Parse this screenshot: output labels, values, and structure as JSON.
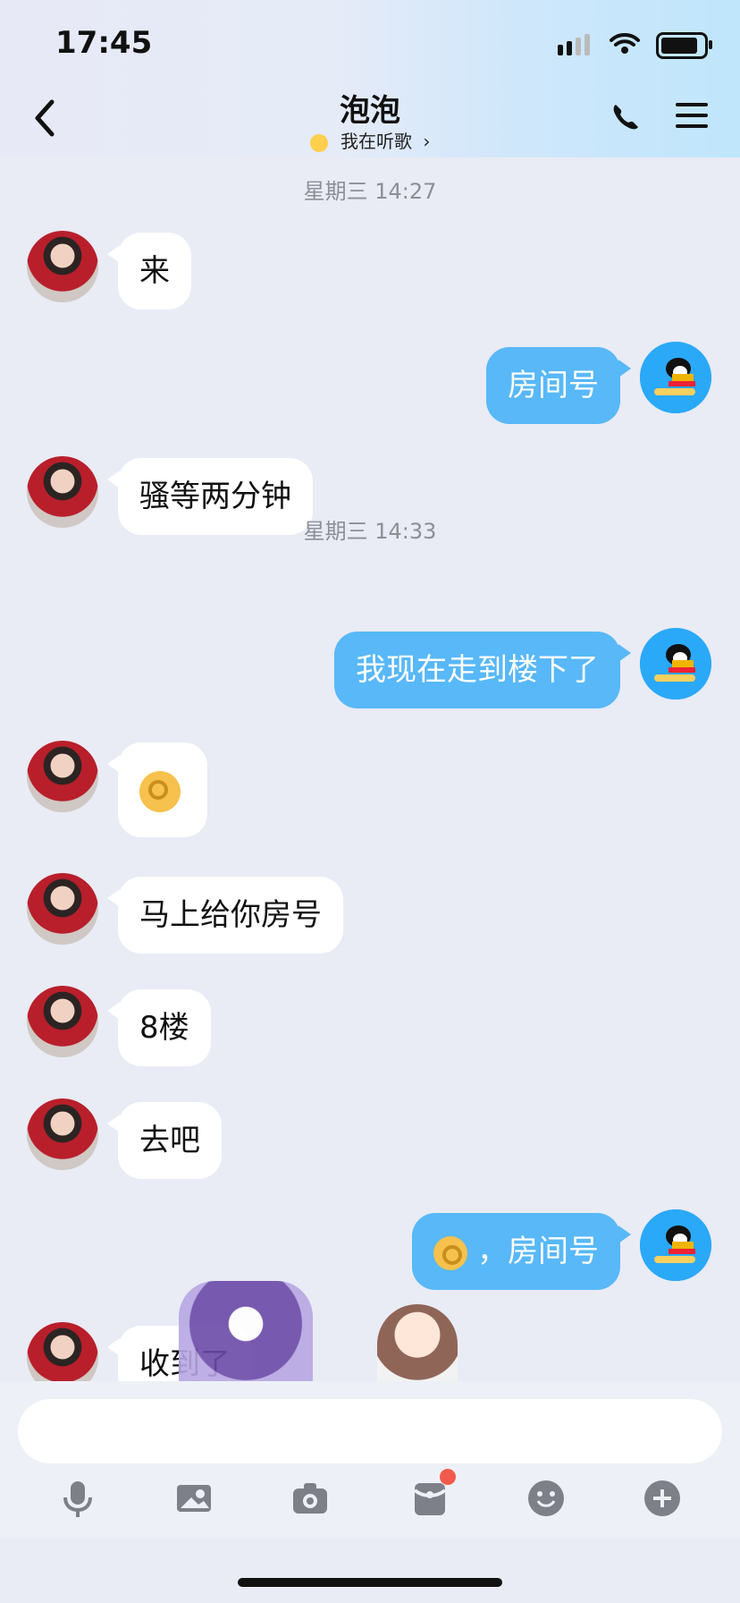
{
  "status_bar": {
    "time": "17:45",
    "icons": [
      "signal-icon",
      "wifi-icon",
      "battery-icon"
    ]
  },
  "header": {
    "title": "泡泡",
    "subtitle": "我在听歌",
    "icons": [
      "back-icon",
      "phone-icon",
      "menu-icon"
    ]
  },
  "chat": {
    "timestamps": [
      "星期三 14:27",
      "星期三 14:33"
    ],
    "messages": [
      {
        "from": "other",
        "text": "来"
      },
      {
        "from": "me",
        "text": "房间号"
      },
      {
        "from": "other",
        "text": "骚等两分钟"
      },
      {
        "from": "me",
        "text": "我现在走到楼下了"
      },
      {
        "from": "other",
        "text": "ok-hand-emoji"
      },
      {
        "from": "other",
        "text": "马上给你房号"
      },
      {
        "from": "other",
        "text": "8楼"
      },
      {
        "from": "other",
        "text": "去吧"
      },
      {
        "from": "me",
        "text": "，房间号"
      },
      {
        "from": "other",
        "text": "收到了"
      }
    ]
  },
  "input": {
    "placeholder": ""
  },
  "toolbar": {
    "items": [
      "mic-icon",
      "image-icon",
      "camera-icon",
      "red-packet-icon",
      "emoji-icon",
      "plus-icon"
    ]
  },
  "colors": {
    "background": "#e9ebf5",
    "my_bubble": "#58b8f8",
    "other_bubble": "#ffffff",
    "timestamp": "#8c8f98",
    "badge": "#f25b4b"
  }
}
